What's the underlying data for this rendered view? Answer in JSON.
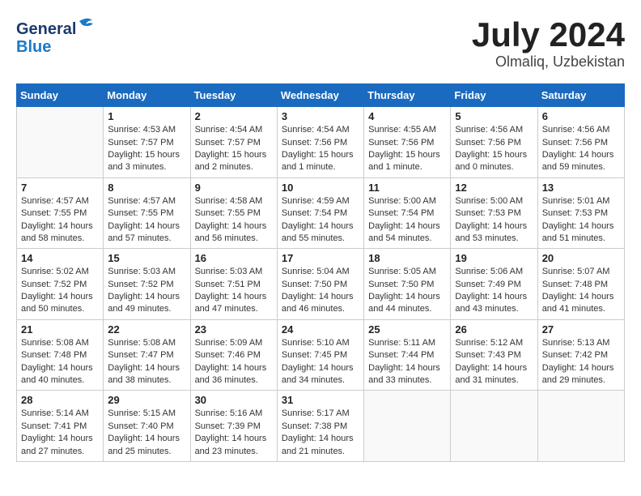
{
  "header": {
    "logo_general": "General",
    "logo_blue": "Blue",
    "month": "July 2024",
    "location": "Olmaliq, Uzbekistan"
  },
  "weekdays": [
    "Sunday",
    "Monday",
    "Tuesday",
    "Wednesday",
    "Thursday",
    "Friday",
    "Saturday"
  ],
  "weeks": [
    [
      {
        "day": "",
        "info": ""
      },
      {
        "day": "1",
        "info": "Sunrise: 4:53 AM\nSunset: 7:57 PM\nDaylight: 15 hours\nand 3 minutes."
      },
      {
        "day": "2",
        "info": "Sunrise: 4:54 AM\nSunset: 7:57 PM\nDaylight: 15 hours\nand 2 minutes."
      },
      {
        "day": "3",
        "info": "Sunrise: 4:54 AM\nSunset: 7:56 PM\nDaylight: 15 hours\nand 1 minute."
      },
      {
        "day": "4",
        "info": "Sunrise: 4:55 AM\nSunset: 7:56 PM\nDaylight: 15 hours\nand 1 minute."
      },
      {
        "day": "5",
        "info": "Sunrise: 4:56 AM\nSunset: 7:56 PM\nDaylight: 15 hours\nand 0 minutes."
      },
      {
        "day": "6",
        "info": "Sunrise: 4:56 AM\nSunset: 7:56 PM\nDaylight: 14 hours\nand 59 minutes."
      }
    ],
    [
      {
        "day": "7",
        "info": "Sunrise: 4:57 AM\nSunset: 7:55 PM\nDaylight: 14 hours\nand 58 minutes."
      },
      {
        "day": "8",
        "info": "Sunrise: 4:57 AM\nSunset: 7:55 PM\nDaylight: 14 hours\nand 57 minutes."
      },
      {
        "day": "9",
        "info": "Sunrise: 4:58 AM\nSunset: 7:55 PM\nDaylight: 14 hours\nand 56 minutes."
      },
      {
        "day": "10",
        "info": "Sunrise: 4:59 AM\nSunset: 7:54 PM\nDaylight: 14 hours\nand 55 minutes."
      },
      {
        "day": "11",
        "info": "Sunrise: 5:00 AM\nSunset: 7:54 PM\nDaylight: 14 hours\nand 54 minutes."
      },
      {
        "day": "12",
        "info": "Sunrise: 5:00 AM\nSunset: 7:53 PM\nDaylight: 14 hours\nand 53 minutes."
      },
      {
        "day": "13",
        "info": "Sunrise: 5:01 AM\nSunset: 7:53 PM\nDaylight: 14 hours\nand 51 minutes."
      }
    ],
    [
      {
        "day": "14",
        "info": "Sunrise: 5:02 AM\nSunset: 7:52 PM\nDaylight: 14 hours\nand 50 minutes."
      },
      {
        "day": "15",
        "info": "Sunrise: 5:03 AM\nSunset: 7:52 PM\nDaylight: 14 hours\nand 49 minutes."
      },
      {
        "day": "16",
        "info": "Sunrise: 5:03 AM\nSunset: 7:51 PM\nDaylight: 14 hours\nand 47 minutes."
      },
      {
        "day": "17",
        "info": "Sunrise: 5:04 AM\nSunset: 7:50 PM\nDaylight: 14 hours\nand 46 minutes."
      },
      {
        "day": "18",
        "info": "Sunrise: 5:05 AM\nSunset: 7:50 PM\nDaylight: 14 hours\nand 44 minutes."
      },
      {
        "day": "19",
        "info": "Sunrise: 5:06 AM\nSunset: 7:49 PM\nDaylight: 14 hours\nand 43 minutes."
      },
      {
        "day": "20",
        "info": "Sunrise: 5:07 AM\nSunset: 7:48 PM\nDaylight: 14 hours\nand 41 minutes."
      }
    ],
    [
      {
        "day": "21",
        "info": "Sunrise: 5:08 AM\nSunset: 7:48 PM\nDaylight: 14 hours\nand 40 minutes."
      },
      {
        "day": "22",
        "info": "Sunrise: 5:08 AM\nSunset: 7:47 PM\nDaylight: 14 hours\nand 38 minutes."
      },
      {
        "day": "23",
        "info": "Sunrise: 5:09 AM\nSunset: 7:46 PM\nDaylight: 14 hours\nand 36 minutes."
      },
      {
        "day": "24",
        "info": "Sunrise: 5:10 AM\nSunset: 7:45 PM\nDaylight: 14 hours\nand 34 minutes."
      },
      {
        "day": "25",
        "info": "Sunrise: 5:11 AM\nSunset: 7:44 PM\nDaylight: 14 hours\nand 33 minutes."
      },
      {
        "day": "26",
        "info": "Sunrise: 5:12 AM\nSunset: 7:43 PM\nDaylight: 14 hours\nand 31 minutes."
      },
      {
        "day": "27",
        "info": "Sunrise: 5:13 AM\nSunset: 7:42 PM\nDaylight: 14 hours\nand 29 minutes."
      }
    ],
    [
      {
        "day": "28",
        "info": "Sunrise: 5:14 AM\nSunset: 7:41 PM\nDaylight: 14 hours\nand 27 minutes."
      },
      {
        "day": "29",
        "info": "Sunrise: 5:15 AM\nSunset: 7:40 PM\nDaylight: 14 hours\nand 25 minutes."
      },
      {
        "day": "30",
        "info": "Sunrise: 5:16 AM\nSunset: 7:39 PM\nDaylight: 14 hours\nand 23 minutes."
      },
      {
        "day": "31",
        "info": "Sunrise: 5:17 AM\nSunset: 7:38 PM\nDaylight: 14 hours\nand 21 minutes."
      },
      {
        "day": "",
        "info": ""
      },
      {
        "day": "",
        "info": ""
      },
      {
        "day": "",
        "info": ""
      }
    ]
  ]
}
